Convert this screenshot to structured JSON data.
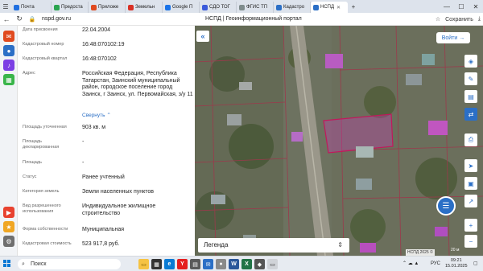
{
  "browser": {
    "tabs": [
      {
        "label": "Почта",
        "color": "#1f6fe0",
        "active": false
      },
      {
        "label": "Предоста",
        "color": "#2aa44f",
        "active": false
      },
      {
        "label": "Приложе",
        "color": "#e04a1f",
        "active": false
      },
      {
        "label": "Земельн",
        "color": "#d93025",
        "active": false
      },
      {
        "label": "Google П",
        "color": "#1a73e8",
        "active": false
      },
      {
        "label": "СДО ТОГ",
        "color": "#3b5bdb",
        "active": false
      },
      {
        "label": "ФГИС ТП",
        "color": "#7f8c8d",
        "active": false
      },
      {
        "label": "Кадастро",
        "color": "#2b6fc6",
        "active": false
      },
      {
        "label": "НСПД",
        "color": "#2b6fc6",
        "active": true
      }
    ],
    "url": "nspd.gov.ru",
    "page_title": "НСПД | Геоинформационный портал",
    "save_label": "Сохранить"
  },
  "info": {
    "rows": [
      {
        "label": "Дата присвоения",
        "value": "22.04.2004"
      },
      {
        "label": "Кадастровый номер",
        "value": "16:48:070102:19"
      },
      {
        "label": "Кадастровый квартал",
        "value": "16:48:070102"
      },
      {
        "label": "Адрес",
        "value": "Российская Федерация, Республика Татарстан, Заинский муниципальный район, городское поселение город Заинск, г Заинск, ул. Первомайская, з/у 11"
      },
      {
        "label": "Площадь уточненная",
        "value": "903 кв. м"
      },
      {
        "label": "Площадь декларированная",
        "value": "-"
      },
      {
        "label": "Площадь",
        "value": "-"
      },
      {
        "label": "Статус",
        "value": "Ранее учтенный"
      },
      {
        "label": "Категория земель",
        "value": "Земли населенных пунктов"
      },
      {
        "label": "Вид разрешенного использования",
        "value": "Индивидуальное жилищное строительство"
      },
      {
        "label": "Форма собственности",
        "value": "Муниципальная"
      },
      {
        "label": "Кадастровая стоимость",
        "value": "523 917,8 руб."
      }
    ],
    "collapse_link": "Свернуть"
  },
  "map": {
    "login_label": "Войти",
    "legend_label": "Легенда",
    "attribution": "НСПД 2025 ©",
    "scale_label": "20 м"
  },
  "taskbar": {
    "search_placeholder": "Поиск",
    "language": "РУС",
    "time": "09:21",
    "date": "15.01.2025"
  }
}
